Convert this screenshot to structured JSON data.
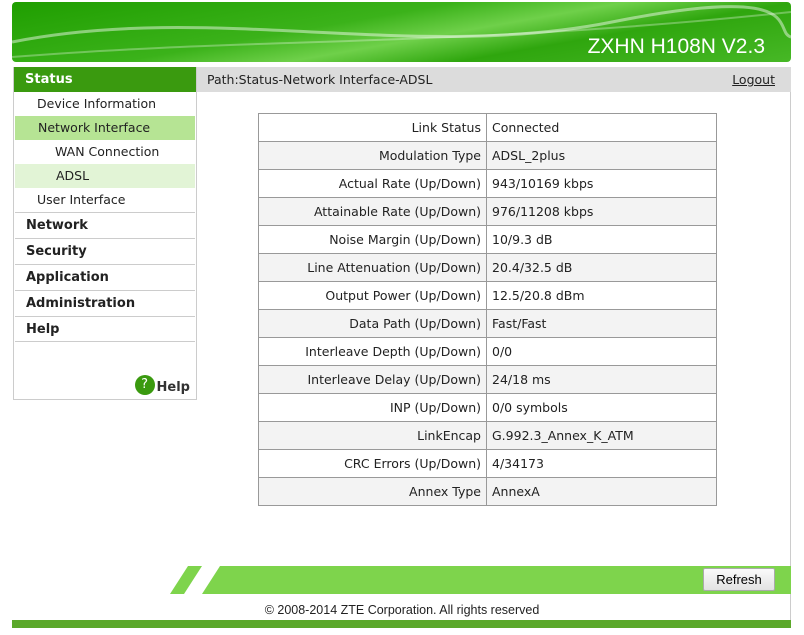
{
  "header": {
    "brand": "ZXHN H108N V2.3"
  },
  "sidebar": {
    "status": "Status",
    "device_information": "Device Information",
    "network_interface": "Network Interface",
    "wan_connection": "WAN Connection",
    "adsl": "ADSL",
    "user_interface": "User Interface",
    "network": "Network",
    "security": "Security",
    "application": "Application",
    "administration": "Administration",
    "help": "Help",
    "help_button": "Help"
  },
  "path": {
    "text": "Path:Status-Network Interface-ADSL",
    "logout": "Logout"
  },
  "table": [
    {
      "label": "Link Status",
      "value": "Connected"
    },
    {
      "label": "Modulation Type",
      "value": "ADSL_2plus"
    },
    {
      "label": "Actual Rate (Up/Down)",
      "value": "943/10169 kbps"
    },
    {
      "label": "Attainable Rate (Up/Down)",
      "value": "976/11208 kbps"
    },
    {
      "label": "Noise Margin (Up/Down)",
      "value": "10/9.3 dB"
    },
    {
      "label": "Line Attenuation (Up/Down)",
      "value": "20.4/32.5 dB"
    },
    {
      "label": "Output Power (Up/Down)",
      "value": "12.5/20.8 dBm"
    },
    {
      "label": "Data Path (Up/Down)",
      "value": "Fast/Fast"
    },
    {
      "label": "Interleave Depth (Up/Down)",
      "value": "0/0"
    },
    {
      "label": "Interleave Delay (Up/Down)",
      "value": "24/18 ms"
    },
    {
      "label": "INP (Up/Down)",
      "value": "0/0 symbols"
    },
    {
      "label": "LinkEncap",
      "value": "G.992.3_Annex_K_ATM"
    },
    {
      "label": "CRC Errors (Up/Down)",
      "value": "4/34173"
    },
    {
      "label": "Annex Type",
      "value": "AnnexA"
    }
  ],
  "footer": {
    "refresh": "Refresh",
    "copyright": "© 2008-2014 ZTE Corporation. All rights reserved"
  }
}
